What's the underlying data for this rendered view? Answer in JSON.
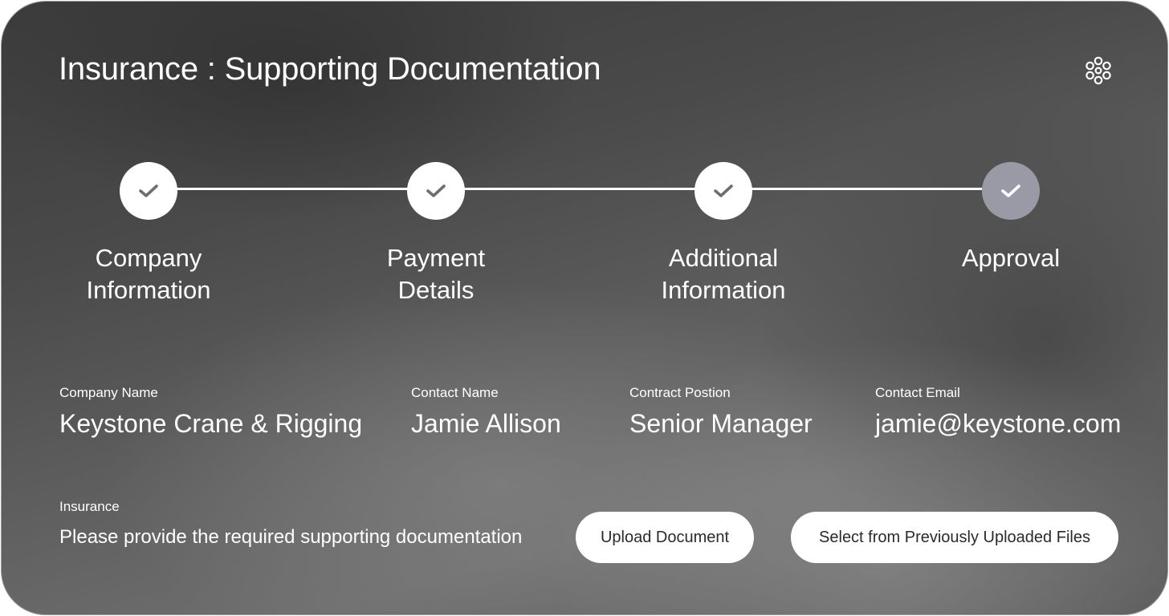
{
  "header": {
    "title": "Insurance : Supporting Documentation",
    "logo_icon": "asterisk-flower-icon"
  },
  "stepper": {
    "steps": [
      {
        "label": "Company\nInformation",
        "state": "complete"
      },
      {
        "label": "Payment\nDetails",
        "state": "complete"
      },
      {
        "label": "Additional\nInformation",
        "state": "complete"
      },
      {
        "label": "Approval",
        "state": "current"
      }
    ],
    "check_icon": "check-icon"
  },
  "fields": {
    "company_name": {
      "label": "Company Name",
      "value": "Keystone Crane & Rigging"
    },
    "contact_name": {
      "label": "Contact Name",
      "value": "Jamie Allison"
    },
    "contract_position": {
      "label": "Contract Postion",
      "value": "Senior Manager"
    },
    "contact_email": {
      "label": "Contact Email",
      "value": "jamie@keystone.com"
    }
  },
  "insurance": {
    "label": "Insurance",
    "prompt": "Please provide the required supporting documentation",
    "upload_button": "Upload Document",
    "select_button": "Select from Previously Uploaded Files"
  },
  "colors": {
    "step_complete": "#ffffff",
    "step_current": "#9a9aa6",
    "check_complete": "#6e6e6e",
    "check_current": "#ffffff"
  }
}
